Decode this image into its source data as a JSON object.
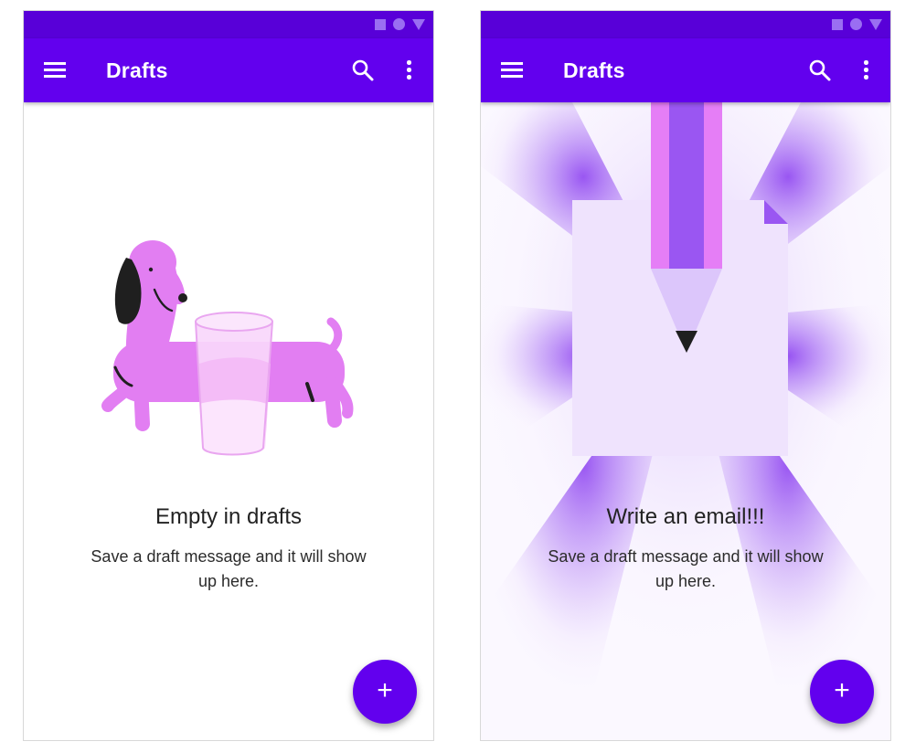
{
  "screens": {
    "left": {
      "appbar": {
        "title": "Drafts"
      },
      "empty_state": {
        "title": "Empty in drafts",
        "message": "Save a draft message and it will show up here."
      },
      "fab": {
        "label": "+"
      },
      "illustration": "dog-with-glass-illustration"
    },
    "right": {
      "appbar": {
        "title": "Drafts"
      },
      "empty_state": {
        "title": "Write an email!!!",
        "message": "Save a draft message and it will show up here."
      },
      "fab": {
        "label": "+"
      },
      "illustration": "pencil-on-paper-illustration"
    }
  },
  "icons": {
    "menu": "menu-icon",
    "search": "search-icon",
    "more": "more-vert-icon",
    "status": [
      "square-icon",
      "circle-icon",
      "triangle-icon"
    ]
  },
  "colors": {
    "status_bar": "#5800d8",
    "app_bar": "#6200ee",
    "fab": "#6200ee",
    "dog": "#e27ef2",
    "pencil_outer": "#e57ef6",
    "pencil_inner": "#9a56f2",
    "paper": "#efe3fd"
  }
}
